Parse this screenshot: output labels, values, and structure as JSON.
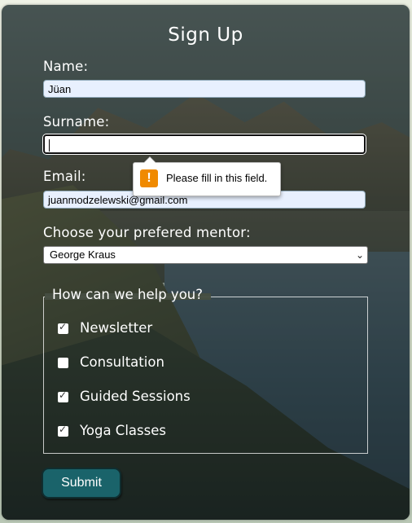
{
  "form": {
    "title": "Sign Up",
    "name_label": "Name:",
    "name_value": "Jüan",
    "surname_label": "Surname:",
    "surname_value": "",
    "email_label": "Email:",
    "email_value": "juanmodzelewski@gmail.com",
    "mentor_label": "Choose your prefered mentor:",
    "mentor_selected": "George Kraus",
    "validation_tooltip": "Please fill in this field.",
    "fieldset_legend": "How can we help you?",
    "options": [
      {
        "label": "Newsletter",
        "checked": true
      },
      {
        "label": "Consultation",
        "checked": false
      },
      {
        "label": "Guided Sessions",
        "checked": true
      },
      {
        "label": "Yoga Classes",
        "checked": true
      }
    ],
    "submit_label": "Submit"
  },
  "icons": {
    "warning": "warning-icon",
    "dropdown": "chevron-down-icon",
    "checkmark": "checkmark-icon"
  },
  "colors": {
    "submit_bg": "#1a636a",
    "warning": "#f08a00",
    "autofill_bg": "#e8f0fe"
  }
}
